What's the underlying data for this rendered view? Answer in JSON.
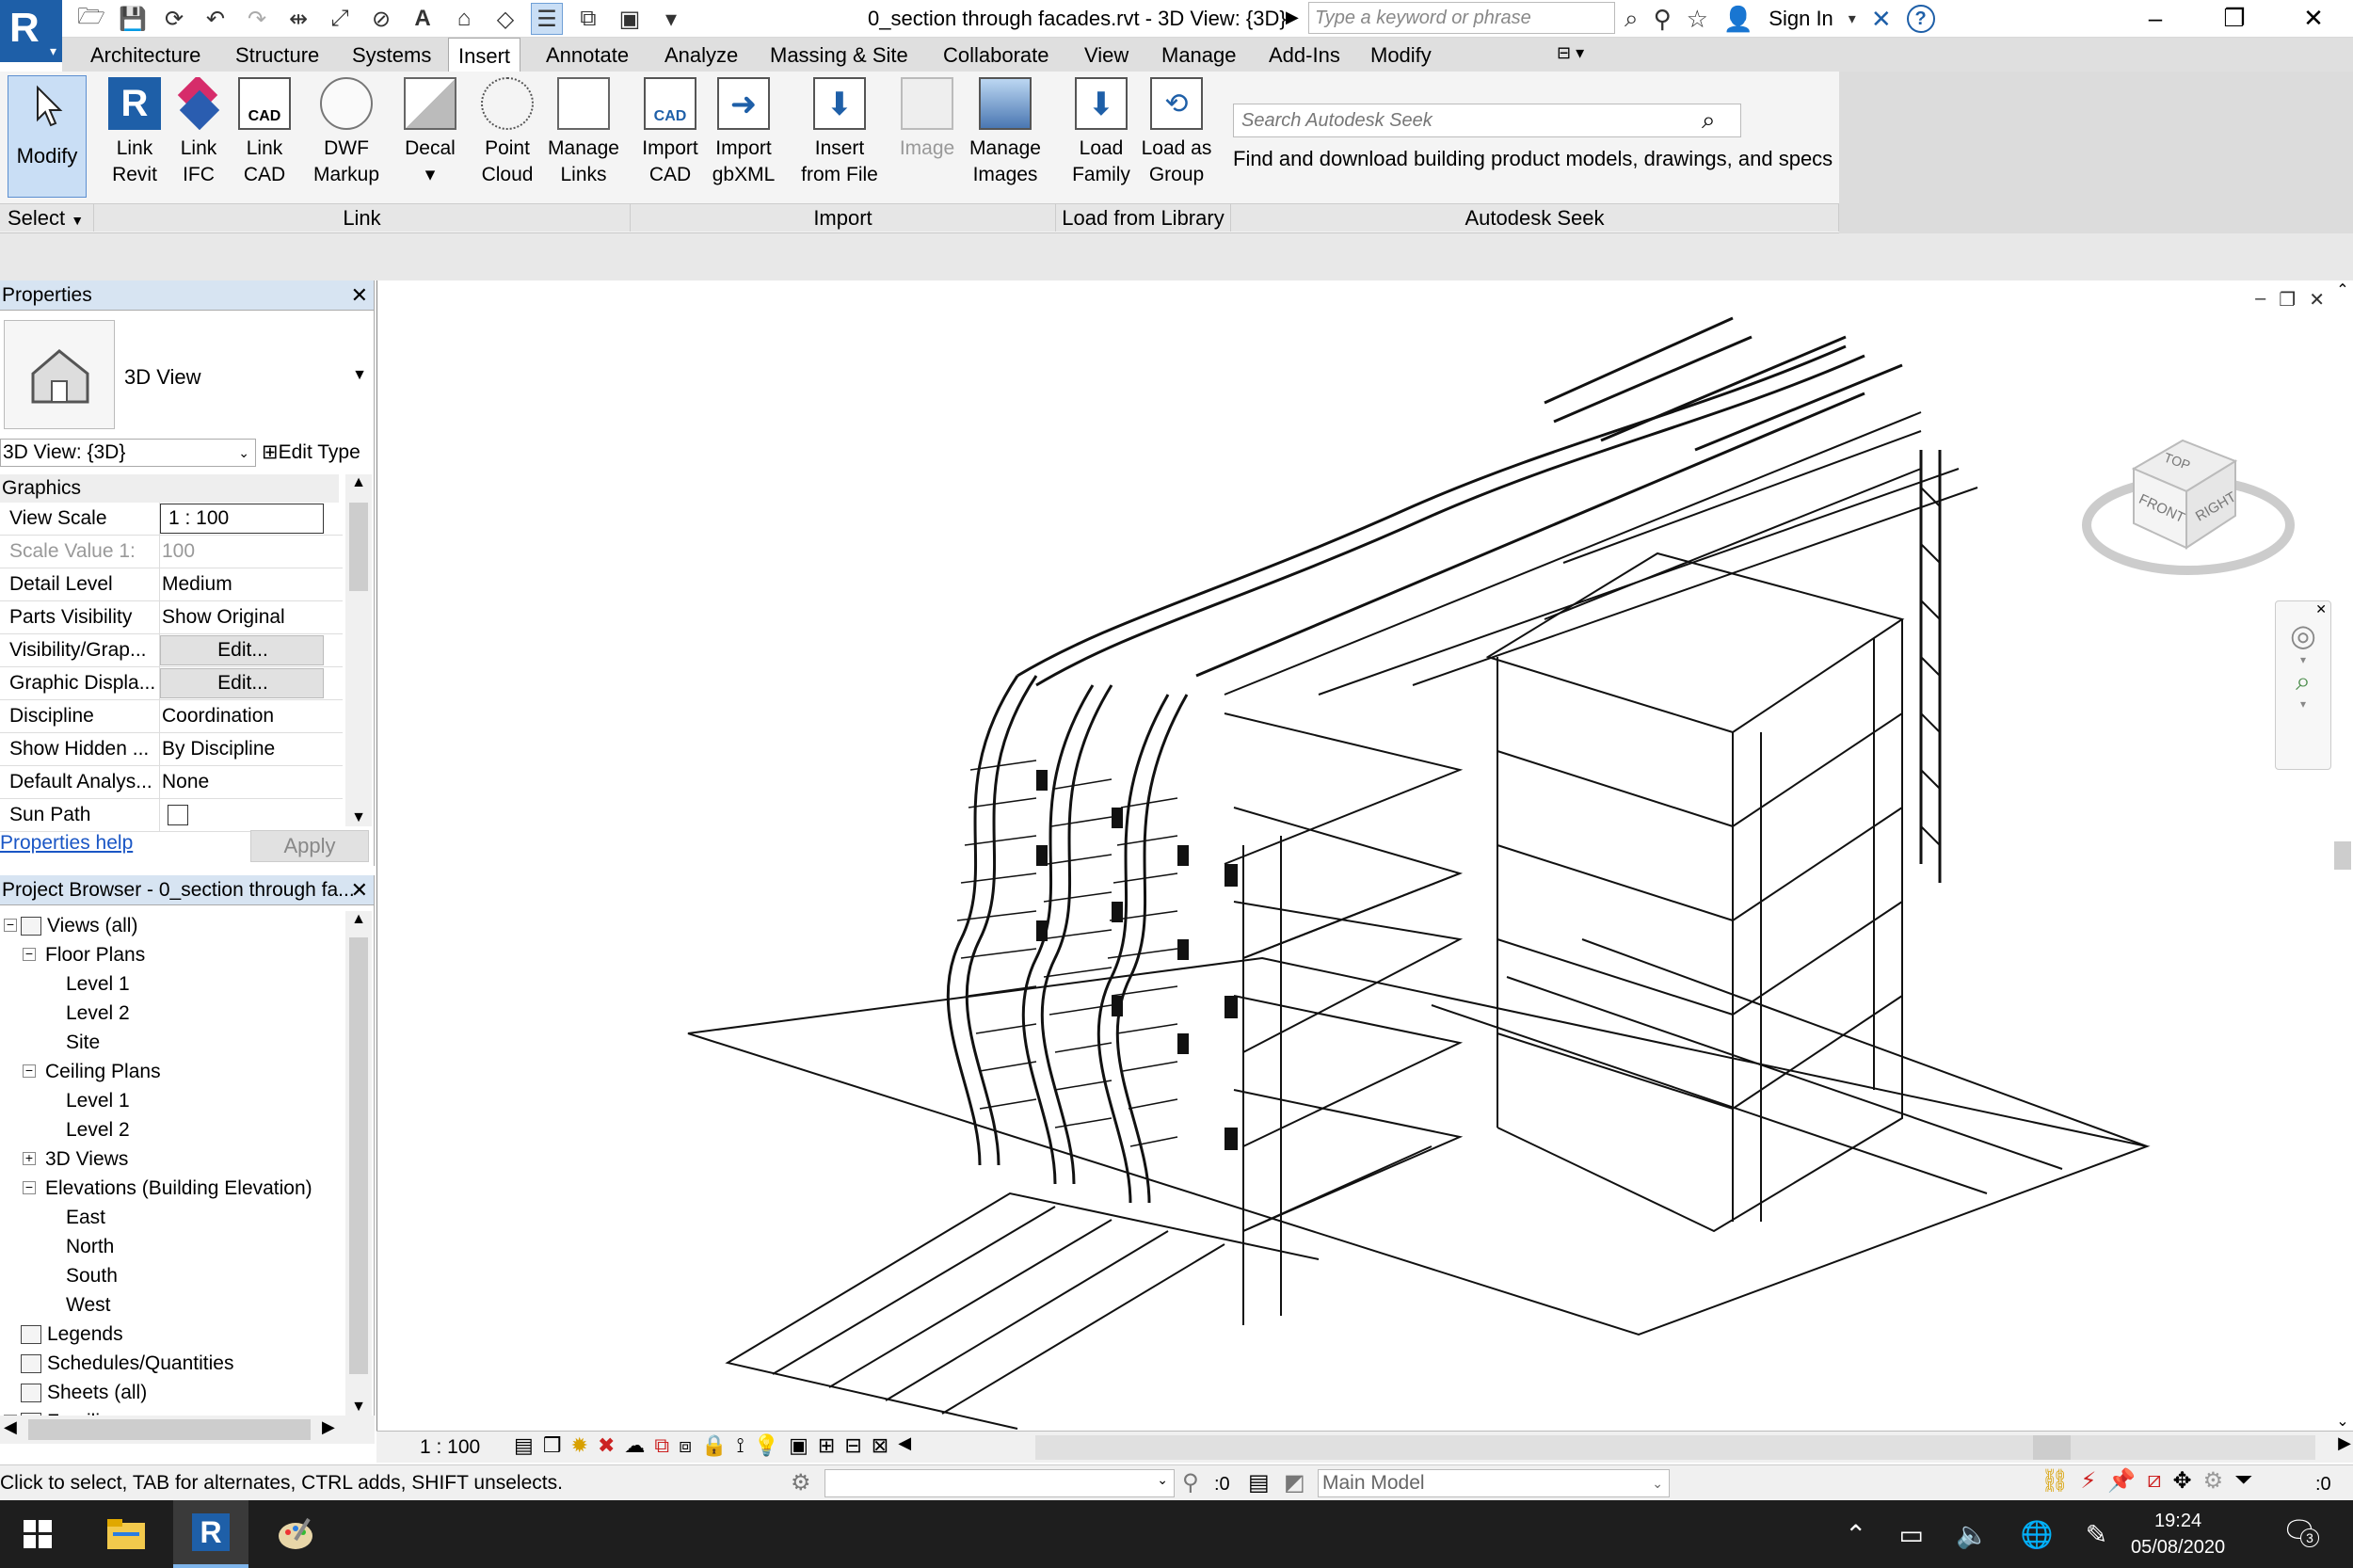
{
  "titlebar": {
    "app_letter": "R",
    "document_title": "0_section through facades.rvt - 3D View: {3D}",
    "search_placeholder": "Type a keyword or phrase",
    "sign_in": "Sign In",
    "help": "?"
  },
  "ribbon": {
    "tabs": [
      "Architecture",
      "Structure",
      "Systems",
      "Insert",
      "Annotate",
      "Analyze",
      "Massing & Site",
      "Collaborate",
      "View",
      "Manage",
      "Add-Ins",
      "Modify"
    ],
    "active_tab": "Insert",
    "modify_label": "Modify",
    "select_label": "Select",
    "buttons": {
      "link_revit": [
        "Link",
        "Revit"
      ],
      "link_ifc": [
        "Link",
        "IFC"
      ],
      "link_cad": [
        "Link",
        "CAD"
      ],
      "dwf_markup": [
        "DWF",
        "Markup"
      ],
      "decal": [
        "Decal",
        ""
      ],
      "point_cloud": [
        "Point",
        "Cloud"
      ],
      "manage_links": [
        "Manage",
        "Links"
      ],
      "import_cad": [
        "Import",
        "CAD"
      ],
      "import_gbxml": [
        "Import",
        "gbXML"
      ],
      "insert_from_file": [
        "Insert",
        "from File"
      ],
      "image": [
        "Image",
        ""
      ],
      "manage_images": [
        "Manage",
        "Images"
      ],
      "load_family": [
        "Load",
        "Family"
      ],
      "load_as_group": [
        "Load as",
        "Group"
      ]
    },
    "groups": [
      "Link",
      "Import",
      "Load from Library",
      "Autodesk Seek"
    ],
    "seek": {
      "placeholder": "Search Autodesk Seek",
      "description": "Find and download building product models, drawings, and specs"
    }
  },
  "properties": {
    "title": "Properties",
    "type_name": "3D View",
    "view_selector": "3D View: {3D}",
    "edit_type": "Edit Type",
    "section": "Graphics",
    "rows": [
      {
        "key": "View Scale",
        "value": "1 : 100"
      },
      {
        "key": "Scale Value    1:",
        "value": "100"
      },
      {
        "key": "Detail Level",
        "value": "Medium"
      },
      {
        "key": "Parts Visibility",
        "value": "Show Original"
      },
      {
        "key": "Visibility/Grap...",
        "value": "Edit..."
      },
      {
        "key": "Graphic Displa...",
        "value": "Edit..."
      },
      {
        "key": "Discipline",
        "value": "Coordination"
      },
      {
        "key": "Show Hidden ...",
        "value": "By Discipline"
      },
      {
        "key": "Default Analys...",
        "value": "None"
      },
      {
        "key": "Sun Path",
        "value": ""
      }
    ],
    "help_link": "Properties help",
    "apply": "Apply"
  },
  "browser": {
    "title": "Project Browser - 0_section through fa...",
    "nodes": [
      {
        "label": "Views (all)",
        "level": 0,
        "exp": "−"
      },
      {
        "label": "Floor Plans",
        "level": 1,
        "exp": "−"
      },
      {
        "label": "Level 1",
        "level": 2
      },
      {
        "label": "Level 2",
        "level": 2
      },
      {
        "label": "Site",
        "level": 2
      },
      {
        "label": "Ceiling Plans",
        "level": 1,
        "exp": "−"
      },
      {
        "label": "Level 1",
        "level": 2
      },
      {
        "label": "Level 2",
        "level": 2
      },
      {
        "label": "3D Views",
        "level": 1,
        "exp": "+"
      },
      {
        "label": "Elevations (Building Elevation)",
        "level": 1,
        "exp": "−"
      },
      {
        "label": "East",
        "level": 2
      },
      {
        "label": "North",
        "level": 2
      },
      {
        "label": "South",
        "level": 2
      },
      {
        "label": "West",
        "level": 2
      },
      {
        "label": "Legends",
        "level": 0,
        "icon": true
      },
      {
        "label": "Schedules/Quantities",
        "level": 0,
        "icon": true
      },
      {
        "label": "Sheets (all)",
        "level": 0,
        "icon": true
      },
      {
        "label": "Families",
        "level": 0,
        "icon": true,
        "exp": "+"
      }
    ]
  },
  "viewcube": {
    "top": "TOP",
    "front": "FRONT",
    "right": "RIGHT"
  },
  "viewbar": {
    "scale": "1 : 100"
  },
  "status": {
    "message": "Click to select, TAB for alternates, CTRL adds, SHIFT unselects.",
    "count1": ":0",
    "model": "Main Model",
    "count2": ":0"
  },
  "taskbar": {
    "time": "19:24",
    "date": "05/08/2020",
    "notifications": "3"
  }
}
